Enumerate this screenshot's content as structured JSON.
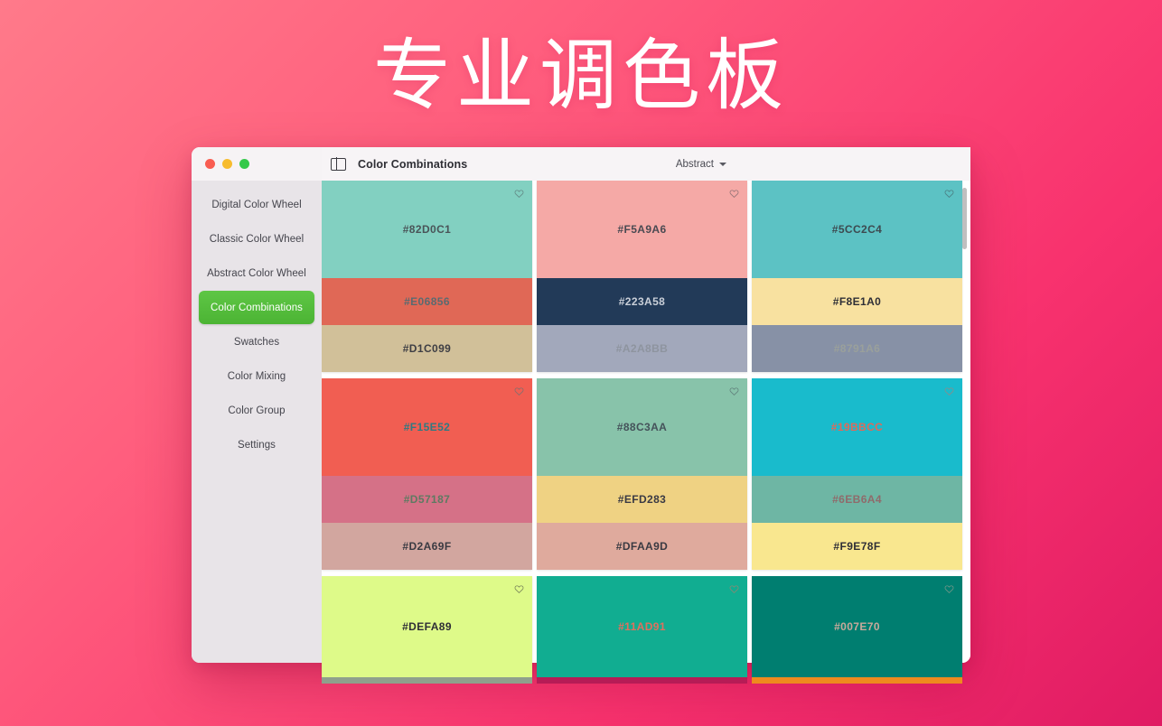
{
  "poster": {
    "title": "专业调色板",
    "background_from": "#FF7A8A",
    "background_to": "#E01B63"
  },
  "window": {
    "traffic_lights": {
      "close_label": "close",
      "minimize_label": "minimize",
      "zoom_label": "zoom",
      "close_color": "#F95D51",
      "minimize_color": "#F7BC2E",
      "zoom_color": "#35C94A"
    },
    "titlebar": {
      "sidebar_toggle_icon": "sidebar-toggle-icon",
      "title": "Color Combinations",
      "mode_value": "Abstract",
      "mode_chevron_icon": "chevron-down-icon"
    }
  },
  "sidebar": {
    "accent_color": "#55BE3E",
    "background": "#E8E4E8",
    "items": [
      {
        "label": "Digital Color Wheel",
        "active": false
      },
      {
        "label": "Classic Color Wheel",
        "active": false
      },
      {
        "label": "Abstract Color Wheel",
        "active": false
      },
      {
        "label": "Color Combinations",
        "active": true
      },
      {
        "label": "Swatches",
        "active": false
      },
      {
        "label": "Color Mixing",
        "active": false
      },
      {
        "label": "Color Group",
        "active": false
      },
      {
        "label": "Settings",
        "active": false
      }
    ]
  },
  "watermark": {
    "text": "专业调色板"
  },
  "scrollbar": {
    "thumb_color": "#BFBFBF"
  },
  "palettes": {
    "columns": [
      {
        "cards": [
          {
            "favorite_icon": "heart-icon",
            "size": "tall",
            "swatches": [
              {
                "hex": "#82D0C1",
                "label": "#82D0C1",
                "text_color": "#4A5458"
              },
              {
                "hex": "#E06856",
                "label": "#E06856",
                "text_color": "#5A6A70"
              },
              {
                "hex": "#D1C099",
                "label": "#D1C099",
                "text_color": "#3E3E44"
              }
            ]
          },
          {
            "favorite_icon": "heart-icon",
            "size": "tall",
            "swatches": [
              {
                "hex": "#F15E52",
                "label": "#F15E52",
                "text_color": "#2F7A82"
              },
              {
                "hex": "#D57187",
                "label": "#D57187",
                "text_color": "#5E7A62"
              },
              {
                "hex": "#D2A69F",
                "label": "#D2A69F",
                "text_color": "#3A3A42"
              }
            ]
          },
          {
            "favorite_icon": "heart-icon",
            "size": "bottom",
            "swatches": [
              {
                "hex": "#DEFA89",
                "label": "#DEFA89",
                "text_color": "#2E2E36"
              }
            ],
            "overflow_color": "#8FA08C"
          }
        ]
      },
      {
        "cards": [
          {
            "favorite_icon": "heart-icon",
            "size": "tall",
            "swatches": [
              {
                "hex": "#F5A9A6",
                "label": "#F5A9A6",
                "text_color": "#4A4A52"
              },
              {
                "hex": "#223A58",
                "label": "#223A58",
                "text_color": "#C9CFD8"
              },
              {
                "hex": "#A2A8BB",
                "label": "#A2A8BB",
                "text_color": "#8E949F"
              }
            ]
          },
          {
            "favorite_icon": "heart-icon",
            "size": "tall",
            "swatches": [
              {
                "hex": "#88C3AA",
                "label": "#88C3AA",
                "text_color": "#45525A"
              },
              {
                "hex": "#EFD283",
                "label": "#EFD283",
                "text_color": "#3A3A44"
              },
              {
                "hex": "#DFAA9D",
                "label": "#DFAA9D",
                "text_color": "#3A3A42"
              }
            ]
          },
          {
            "favorite_icon": "heart-icon",
            "size": "bottom",
            "swatches": [
              {
                "hex": "#11AD91",
                "label": "#11AD91",
                "text_color": "#E0705E"
              }
            ],
            "overflow_color": "#B61C56"
          }
        ]
      },
      {
        "cards": [
          {
            "favorite_icon": "heart-icon",
            "size": "tall",
            "swatches": [
              {
                "hex": "#5CC2C4",
                "label": "#5CC2C4",
                "text_color": "#3D4A50"
              },
              {
                "hex": "#F8E1A0",
                "label": "#F8E1A0",
                "text_color": "#2E2E36"
              },
              {
                "hex": "#8791A6",
                "label": "#8791A6",
                "text_color": "#9AA09B"
              }
            ]
          },
          {
            "favorite_icon": "heart-icon",
            "size": "tall",
            "swatches": [
              {
                "hex": "#19BBCC",
                "label": "#19BBCC",
                "text_color": "#E0695A"
              },
              {
                "hex": "#6EB6A4",
                "label": "#6EB6A4",
                "text_color": "#8F6B6B"
              },
              {
                "hex": "#F9E78F",
                "label": "#F9E78F",
                "text_color": "#2E2E36"
              }
            ]
          },
          {
            "favorite_icon": "heart-icon",
            "size": "bottom",
            "swatches": [
              {
                "hex": "#007E70",
                "label": "#007E70",
                "text_color": "#C9A99B"
              }
            ],
            "overflow_color": "#EE8A1E"
          }
        ]
      }
    ]
  }
}
